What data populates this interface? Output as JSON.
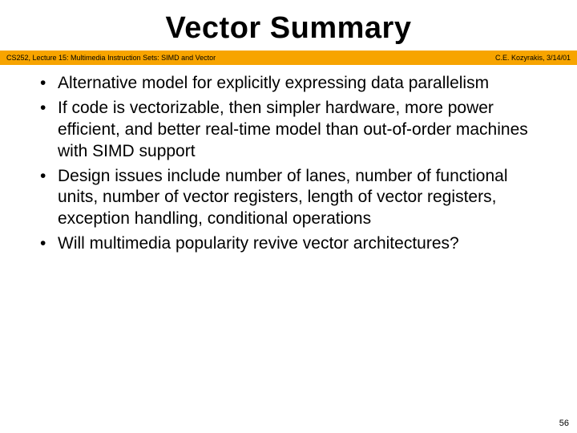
{
  "title": "Vector Summary",
  "bar": {
    "left": "CS252, Lecture 15: Multimedia Instruction Sets: SIMD and Vector",
    "right": "C.E. Kozyrakis, 3/14/01"
  },
  "bullets": [
    "Alternative model for explicitly expressing data parallelism",
    "If code is vectorizable, then simpler hardware, more power efficient, and better real-time model than out-of-order machines with SIMD support",
    "Design issues include number of lanes, number of functional units, number of vector registers, length of vector registers, exception handling, conditional operations",
    "Will multimedia popularity revive vector architectures?"
  ],
  "page_number": "56"
}
